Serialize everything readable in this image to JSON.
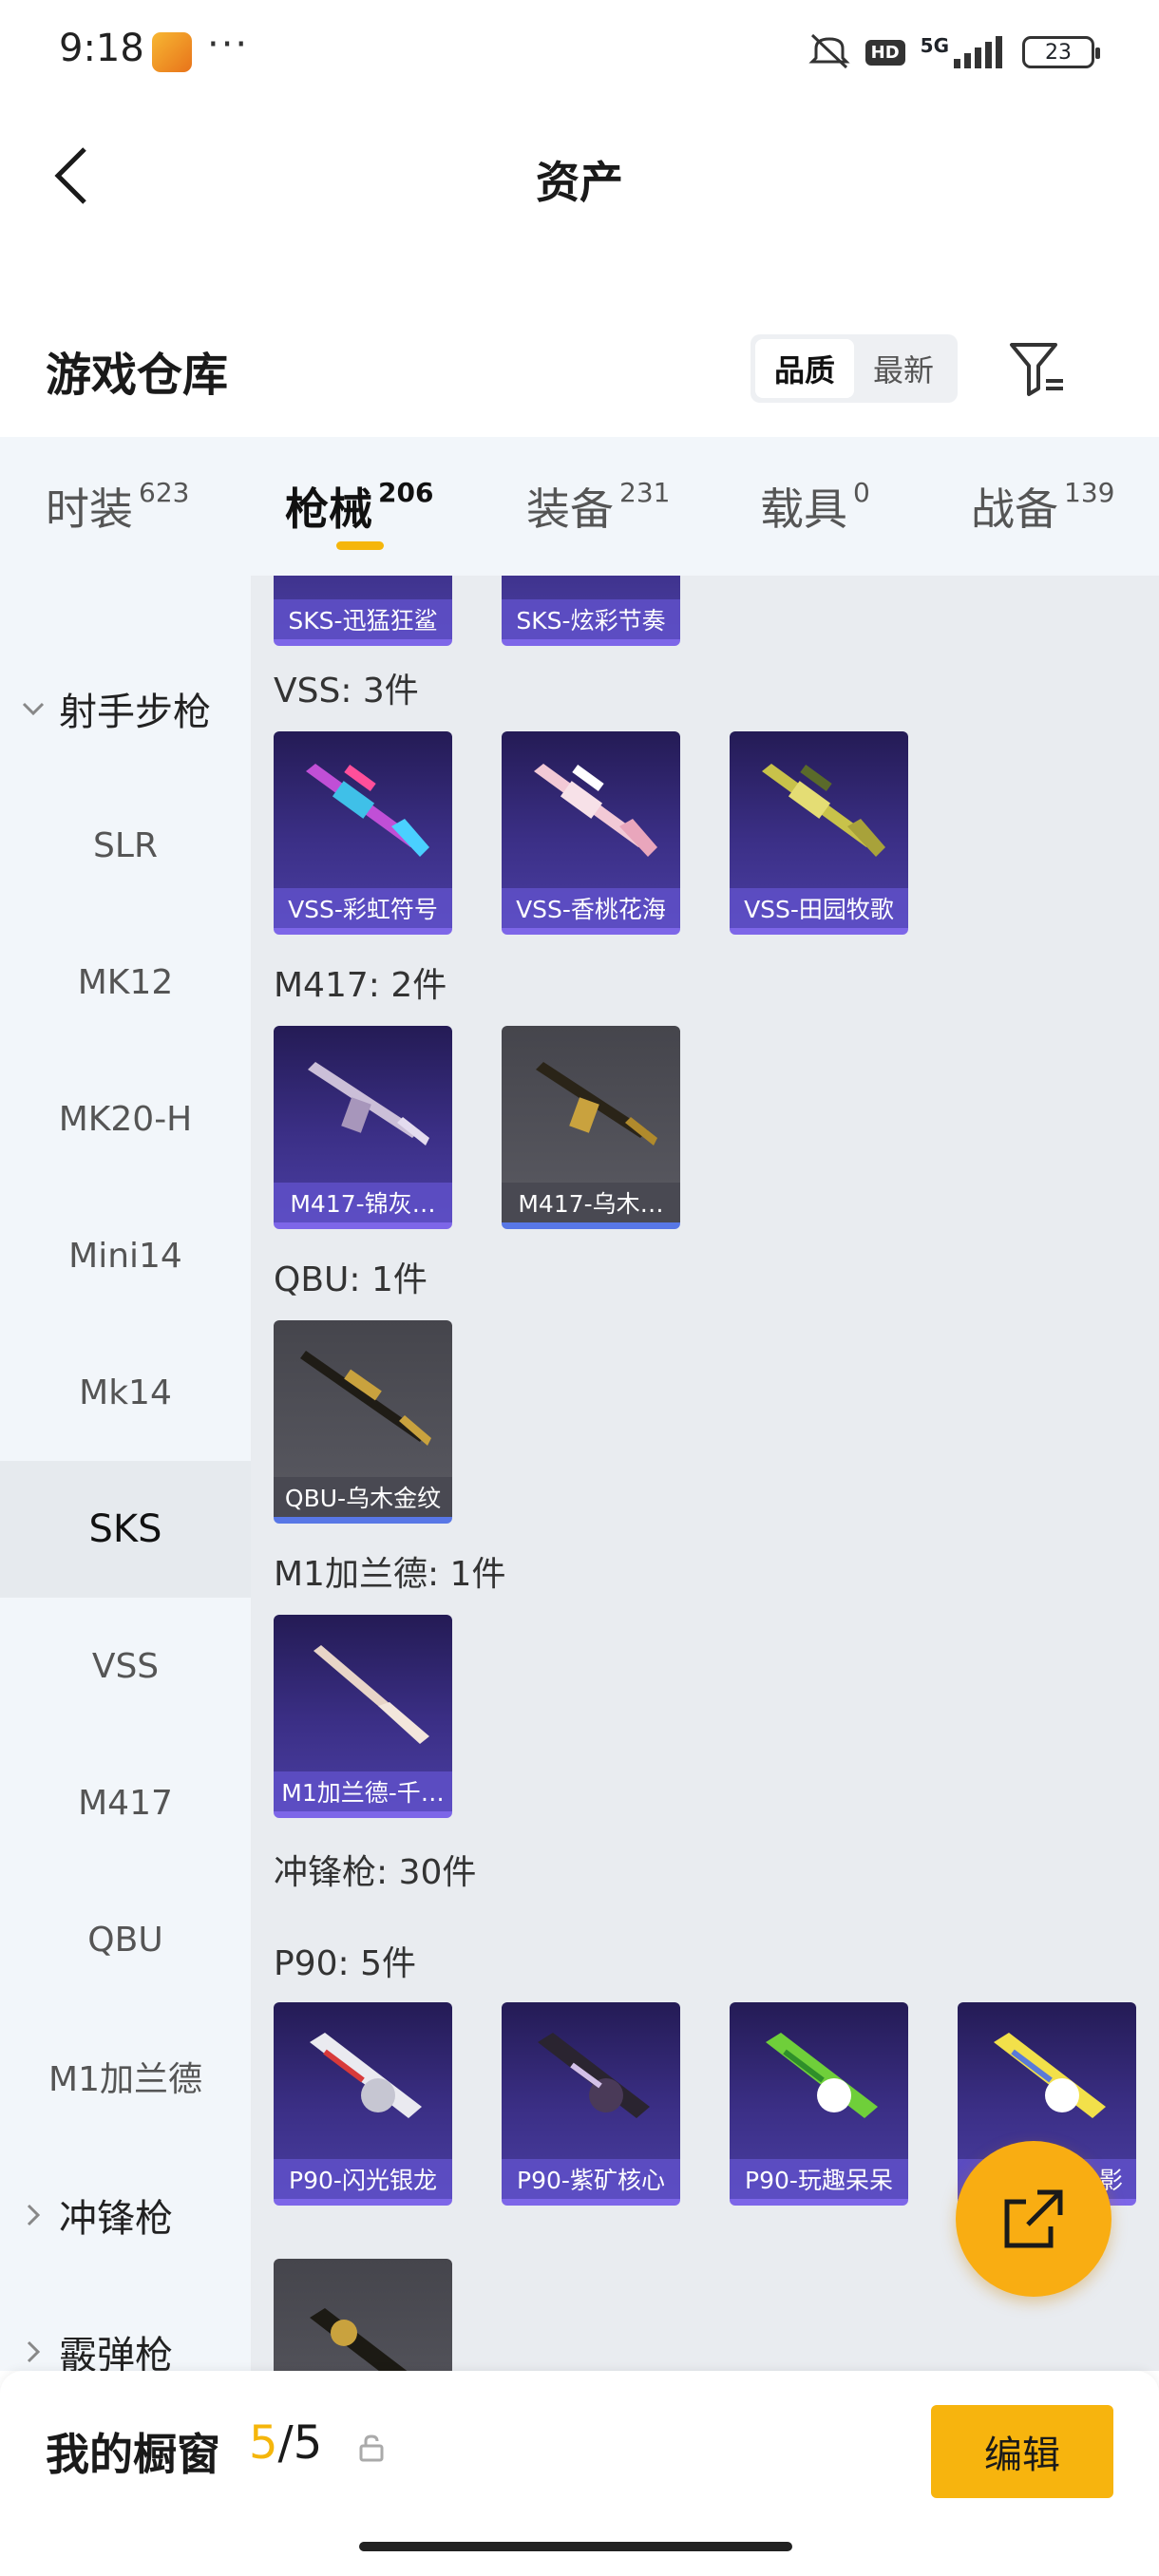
{
  "status_bar": {
    "time": "9:18",
    "dots": "···",
    "net": "5G",
    "hd": "HD",
    "battery": "23"
  },
  "header": {
    "title": "资产"
  },
  "warehouse": {
    "title": "游戏仓库",
    "sort_options": [
      "品质",
      "最新"
    ],
    "active_sort": "品质"
  },
  "tabs": [
    {
      "label": "时装",
      "count": "623"
    },
    {
      "label": "枪械",
      "count": "206"
    },
    {
      "label": "装备",
      "count": "231"
    },
    {
      "label": "载具",
      "count": "0"
    },
    {
      "label": "战备",
      "count": "139"
    }
  ],
  "sidebar": {
    "group_open": "射手步枪",
    "items": [
      "SLR",
      "MK12",
      "MK20-H",
      "Mini14",
      "Mk14",
      "SKS",
      "VSS",
      "M417",
      "QBU",
      "M1加兰德"
    ],
    "active": "SKS",
    "groups_closed": [
      "冲锋枪",
      "霰弹枪"
    ]
  },
  "content": {
    "sks_items": [
      "SKS-迅猛狂鲨",
      "SKS-炫彩节奏"
    ],
    "vss": {
      "label": "VSS: 3件",
      "items": [
        "VSS-彩虹符号",
        "VSS-香桃花海",
        "VSS-田园牧歌"
      ]
    },
    "m417": {
      "label": "M417: 2件",
      "items": [
        "M417-锦灰…",
        "M417-乌木…"
      ]
    },
    "qbu": {
      "label": "QBU: 1件",
      "items": [
        "QBU-乌木金纹"
      ]
    },
    "m1": {
      "label": "M1加兰德: 1件",
      "items": [
        "M1加兰德-千…"
      ]
    },
    "smg_header": "冲锋枪: 30件",
    "p90": {
      "label": "P90: 5件",
      "items": [
        "P90-闪光银龙",
        "P90-紫矿核心",
        "P90-玩趣呆呆",
        "影"
      ]
    }
  },
  "bottom": {
    "showcase_label": "我的橱窗",
    "current": "5",
    "separator": "/",
    "total": "5",
    "edit_label": "编辑"
  },
  "colors": {
    "accent": "#f5b60b",
    "card_purple": "#3b2f86",
    "card_grey": "#55555c",
    "bg": "#e9ecf0"
  }
}
